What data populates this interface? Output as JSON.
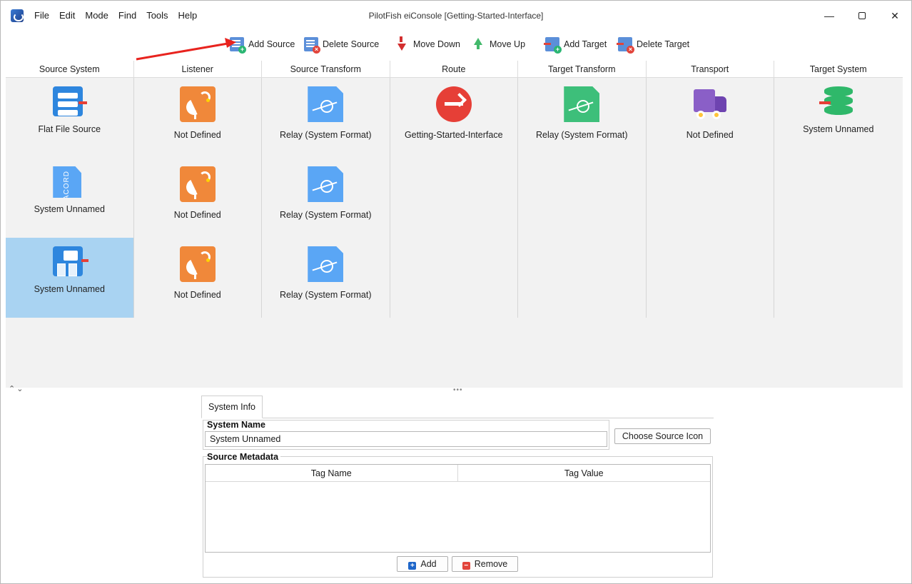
{
  "window": {
    "title": "PilotFish eiConsole [Getting-Started-Interface]",
    "minimize": "—",
    "close": "✕"
  },
  "menu": [
    "File",
    "Edit",
    "Mode",
    "Find",
    "Tools",
    "Help"
  ],
  "toolbar": {
    "add_source": "Add Source",
    "delete_source": "Delete Source",
    "move_down": "Move Down",
    "move_up": "Move Up",
    "add_target": "Add Target",
    "delete_target": "Delete Target"
  },
  "grid": {
    "columns": [
      "Source System",
      "Listener",
      "Source Transform",
      "Route",
      "Target Transform",
      "Transport",
      "Target System"
    ],
    "rows": [
      [
        "Flat File Source",
        "Not Defined",
        "Relay (System Format)",
        "Getting-Started-Interface",
        "Relay (System Format)",
        "Not Defined",
        "System Unnamed"
      ],
      [
        "System Unnamed",
        "Not Defined",
        "Relay (System Format)",
        "",
        "",
        "",
        ""
      ],
      [
        "System Unnamed",
        "Not Defined",
        "Relay (System Format)",
        "",
        "",
        "",
        ""
      ]
    ],
    "acord_icon_text": "ACORD",
    "selected": "row 3, Source System"
  },
  "panel": {
    "tab": "System Info",
    "system_name_label": "System Name",
    "system_name_value": "System Unnamed",
    "choose_icon": "Choose Source Icon",
    "metadata_label": "Source Metadata",
    "columns": [
      "Tag Name",
      "Tag Value"
    ],
    "add": "Add",
    "remove": "Remove"
  },
  "colors": {
    "selection": "#a9d3f2",
    "annotation_arrow": "#e8231e",
    "listener": "#f0883a",
    "transform": "#5aa6f5",
    "route": "#e63f37",
    "transport": "#8a5fc7"
  }
}
